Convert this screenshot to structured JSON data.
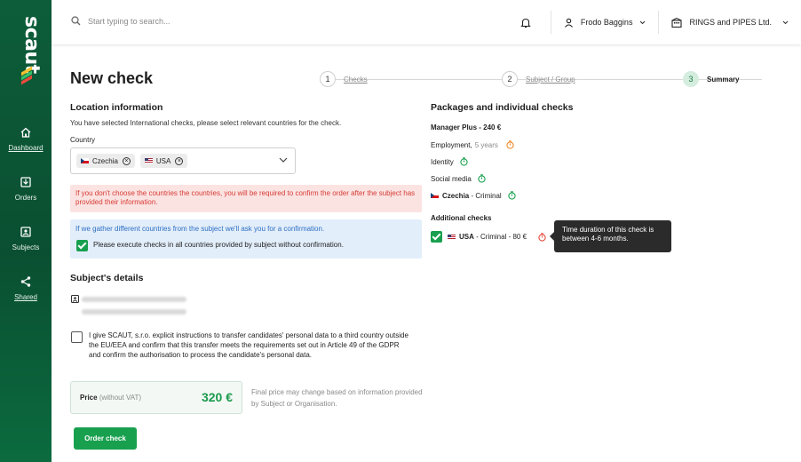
{
  "brand": {
    "name": "scaut"
  },
  "sidebar": {
    "items": [
      {
        "label": "Dashboard",
        "icon": "home-icon"
      },
      {
        "label": "Orders",
        "icon": "orders-icon"
      },
      {
        "label": "Subjects",
        "icon": "subjects-icon"
      },
      {
        "label": "Shared",
        "icon": "share-icon"
      }
    ]
  },
  "header": {
    "search_placeholder": "Start typing to search...",
    "user_name": "Frodo Baggins",
    "company_name": "RINGS and PIPES Ltd."
  },
  "page": {
    "title": "New check",
    "steps": [
      {
        "num": "1",
        "label": "Checks"
      },
      {
        "num": "2",
        "label": "Subject / Group"
      },
      {
        "num": "3",
        "label": "Summary"
      }
    ]
  },
  "location": {
    "heading": "Location information",
    "intro": "You have selected International checks, please select relevant countries for the check.",
    "country_label": "Country",
    "countries": [
      "Czechia",
      "USA"
    ],
    "warning": "If you don't choose the countries the countries, you will be required to confirm the order after the subject has provided their information.",
    "info": "If we gather different countries from the subject we'll ask you for a confirmation.",
    "confirm_label": "Please execute checks in all countries provided by subject without confirmation."
  },
  "subject": {
    "heading": "Subject's details"
  },
  "consent": {
    "text": "I give SCAUT, s.r.o. explicit instructions to transfer candidates' personal data to a third country outside the EU/EEA and confirm that this transfer meets the requirements set out in Article 49 of the GDPR and confirm the authorisation to process the candidate's personal data."
  },
  "price": {
    "label": "Price",
    "label_suffix": "(without VAT)",
    "value": "320 €",
    "note": "Final price may change based on information provided by Subject or Organisation."
  },
  "order_button": "Order check",
  "packages": {
    "heading": "Packages and individual checks",
    "package_name": "Manager Plus - 240 €",
    "items": [
      {
        "label": "Employment,",
        "extra": "5 years",
        "timer": "orange"
      },
      {
        "label": "Identity",
        "extra": "",
        "timer": "green"
      },
      {
        "label": "Social media",
        "extra": "",
        "timer": "green"
      }
    ],
    "czechia_country": "Czechia",
    "czechia_suffix": "- Criminal",
    "additional_heading": "Additional checks",
    "additional_country": "USA",
    "additional_suffix": "- Criminal - 80 €",
    "tooltip": "Time duration of this check is between 4-6 months."
  },
  "colors": {
    "brand_green": "#0d5d3a",
    "accent": "#19a04f",
    "warning": "#d63b35",
    "info": "#2d6fc2"
  }
}
